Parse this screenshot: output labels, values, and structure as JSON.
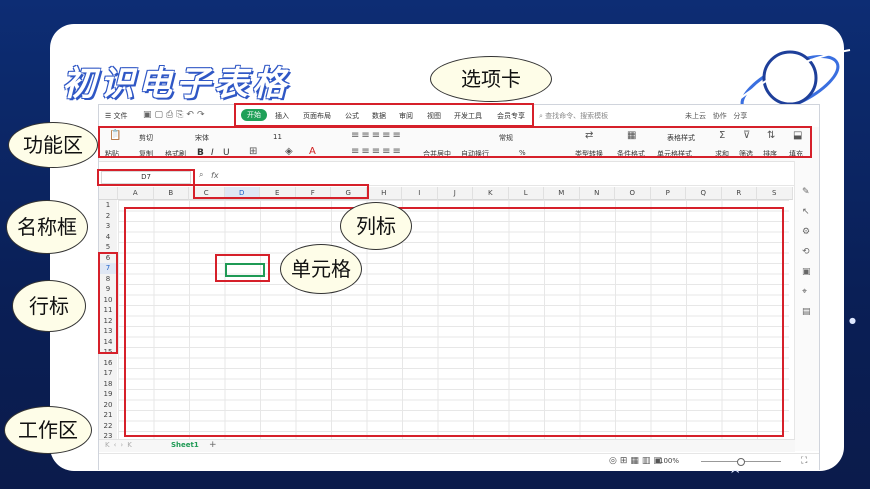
{
  "slide": {
    "title": "初识电子表格"
  },
  "annotations": {
    "tabs": "选项卡",
    "ribbon": "功能区",
    "name_box": "名称框",
    "column_headers": "列标",
    "cell": "单元格",
    "row_headers": "行标",
    "work_area": "工作区"
  },
  "app": {
    "menu_label": "☰ 文件",
    "tabs": [
      "开始",
      "插入",
      "页面布局",
      "公式",
      "数据",
      "审阅",
      "视图",
      "开发工具",
      "会员专享"
    ],
    "search_placeholder": "查找命令、搜索模板",
    "right_buttons": [
      "未上云",
      "协作",
      "分享"
    ],
    "ribbon": {
      "paste": "粘贴",
      "cut": "剪切",
      "copy": "复制",
      "format_painter": "格式刷",
      "font_name": "宋体",
      "font_size": "11",
      "bold": "B",
      "italic": "I",
      "underline": "U",
      "merge_center": "合并居中",
      "wrap_text": "自动换行",
      "number_format": "常规",
      "percent": "%",
      "type_convert": "类型转换",
      "conditional_format": "条件格式",
      "table_style": "表格样式",
      "cell_style": "单元格样式",
      "sum": "求和",
      "filter": "筛选",
      "sort": "排序",
      "fill": "填充"
    },
    "name_box_value": "D7",
    "fx_label": "fx",
    "columns": [
      "A",
      "B",
      "C",
      "D",
      "E",
      "F",
      "G",
      "H",
      "I",
      "J",
      "K",
      "L",
      "M",
      "N",
      "O",
      "P",
      "Q",
      "R",
      "S"
    ],
    "selected_column": "D",
    "rows": [
      "1",
      "2",
      "3",
      "4",
      "5",
      "6",
      "7",
      "8",
      "9",
      "10",
      "11",
      "12",
      "13",
      "14",
      "15",
      "16",
      "17",
      "18",
      "19",
      "20",
      "21",
      "22",
      "23"
    ],
    "selected_row": "7",
    "sheet_tab": "Sheet1",
    "add_sheet": "+",
    "zoom_level": "100%"
  }
}
